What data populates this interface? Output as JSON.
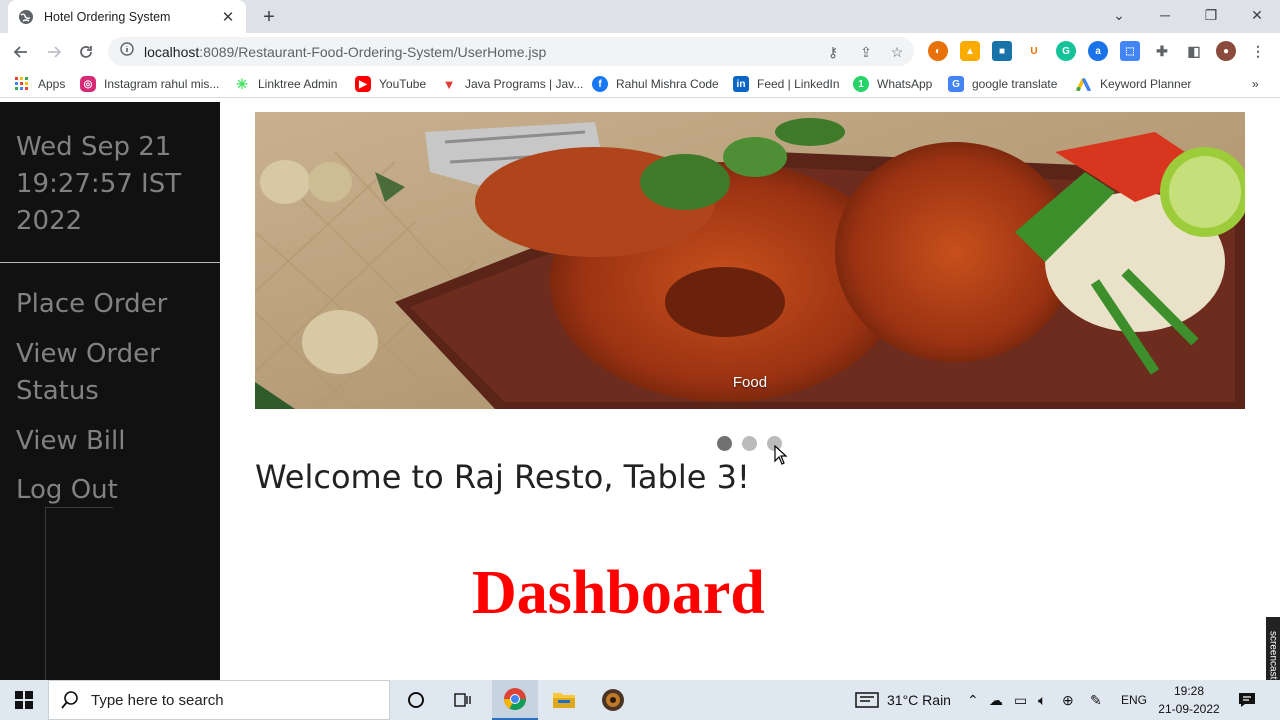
{
  "browser": {
    "tab_title": "Hotel Ordering System",
    "url_host": "localhost",
    "url_rest": ":8089/Restaurant-Food-Ordering-System/UserHome.jsp",
    "bookmarks": [
      {
        "label": "Apps",
        "icon": "apps-grid-icon"
      },
      {
        "label": "Instagram rahul mis...",
        "icon": "instagram-icon"
      },
      {
        "label": "Linktree Admin",
        "icon": "linktree-icon"
      },
      {
        "label": "YouTube",
        "icon": "youtube-icon"
      },
      {
        "label": "Java Programs | Jav...",
        "icon": "java-icon"
      },
      {
        "label": "Rahul Mishra Code",
        "icon": "facebook-icon"
      },
      {
        "label": "Feed | LinkedIn",
        "icon": "linkedin-icon"
      },
      {
        "label": "WhatsApp",
        "icon": "whatsapp-icon"
      },
      {
        "label": "google translate",
        "icon": "translate-icon"
      },
      {
        "label": "Keyword Planner",
        "icon": "google-ads-icon"
      }
    ],
    "more_bookmarks": "»"
  },
  "sidebar": {
    "clock": "Wed Sep 21 19:27:57 IST 2022",
    "links": [
      {
        "label": "Place Order"
      },
      {
        "label": "View Order Status"
      },
      {
        "label": "View Bill"
      },
      {
        "label": "Log Out"
      }
    ]
  },
  "main": {
    "carousel_caption": "Food",
    "carousel_dots": 3,
    "welcome": "Welcome to Raj Resto, Table 3!",
    "heading": "Dashboard"
  },
  "overlay": {
    "screencast_label": "screencast"
  },
  "taskbar": {
    "search_placeholder": "Type here to search",
    "weather": "31°C  Rain",
    "language": "ENG",
    "time": "19:28",
    "date": "21-09-2022"
  },
  "colors": {
    "sidebar_bg": "#111111",
    "sidebar_text": "#818181",
    "heading_red": "#ff0000"
  }
}
